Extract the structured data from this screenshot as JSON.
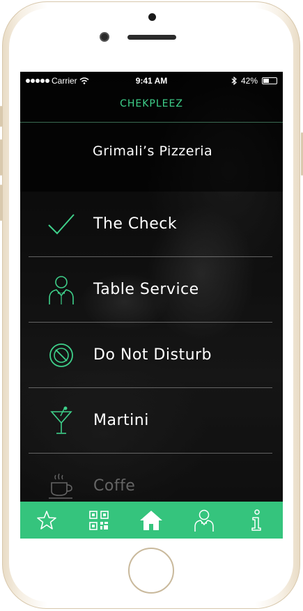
{
  "status_bar": {
    "carrier": "Carrier",
    "time": "9:41 AM",
    "battery": "42%",
    "battery_level": 0.42
  },
  "app": {
    "title": "CHEKPLEEZ",
    "accent_color": "#35c47d"
  },
  "restaurant": {
    "name": "Grimali’s Pizzeria"
  },
  "menu": {
    "items": [
      {
        "label": "The Check",
        "icon": "checkmark-icon"
      },
      {
        "label": "Table Service",
        "icon": "waiter-icon"
      },
      {
        "label": "Do Not Disturb",
        "icon": "do-not-disturb-icon"
      },
      {
        "label": "Martini",
        "icon": "martini-icon"
      },
      {
        "label": "Coffe",
        "icon": "coffee-cup-icon"
      }
    ]
  },
  "tab_bar": {
    "tabs": [
      {
        "icon": "star-icon"
      },
      {
        "icon": "qr-code-icon"
      },
      {
        "icon": "home-icon",
        "active": true
      },
      {
        "icon": "waiter-icon"
      },
      {
        "icon": "info-icon"
      }
    ]
  }
}
